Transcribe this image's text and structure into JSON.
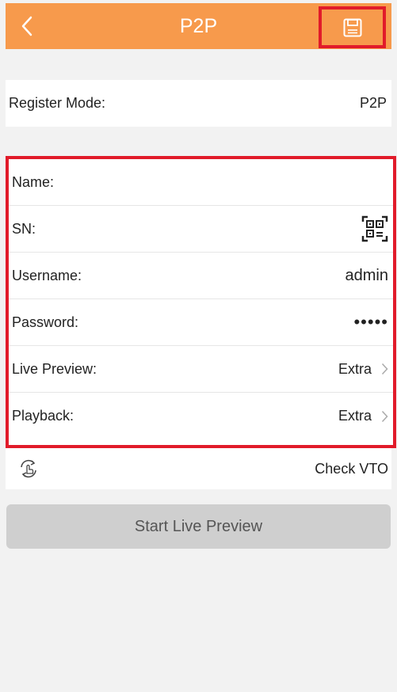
{
  "header": {
    "title": "P2P",
    "back_icon": "chevron-left-icon",
    "save_icon": "save-icon"
  },
  "register": {
    "label": "Register Mode:",
    "value": "P2P"
  },
  "form": {
    "name_label": "Name:",
    "sn_label": "SN:",
    "sn_icon": "qr-scan-icon",
    "username_label": "Username:",
    "username_value": "admin",
    "password_label": "Password:",
    "password_value": "•••••",
    "live_preview_label": "Live Preview:",
    "live_preview_value": "Extra",
    "playback_label": "Playback:",
    "playback_value": "Extra"
  },
  "vto": {
    "icon": "rotate-hand-icon",
    "label": "Check VTO"
  },
  "start_button": "Start Live Preview",
  "colors": {
    "header": "#f79a4c",
    "highlight": "#e11b2a",
    "button_disabled": "#cfcfcf"
  }
}
